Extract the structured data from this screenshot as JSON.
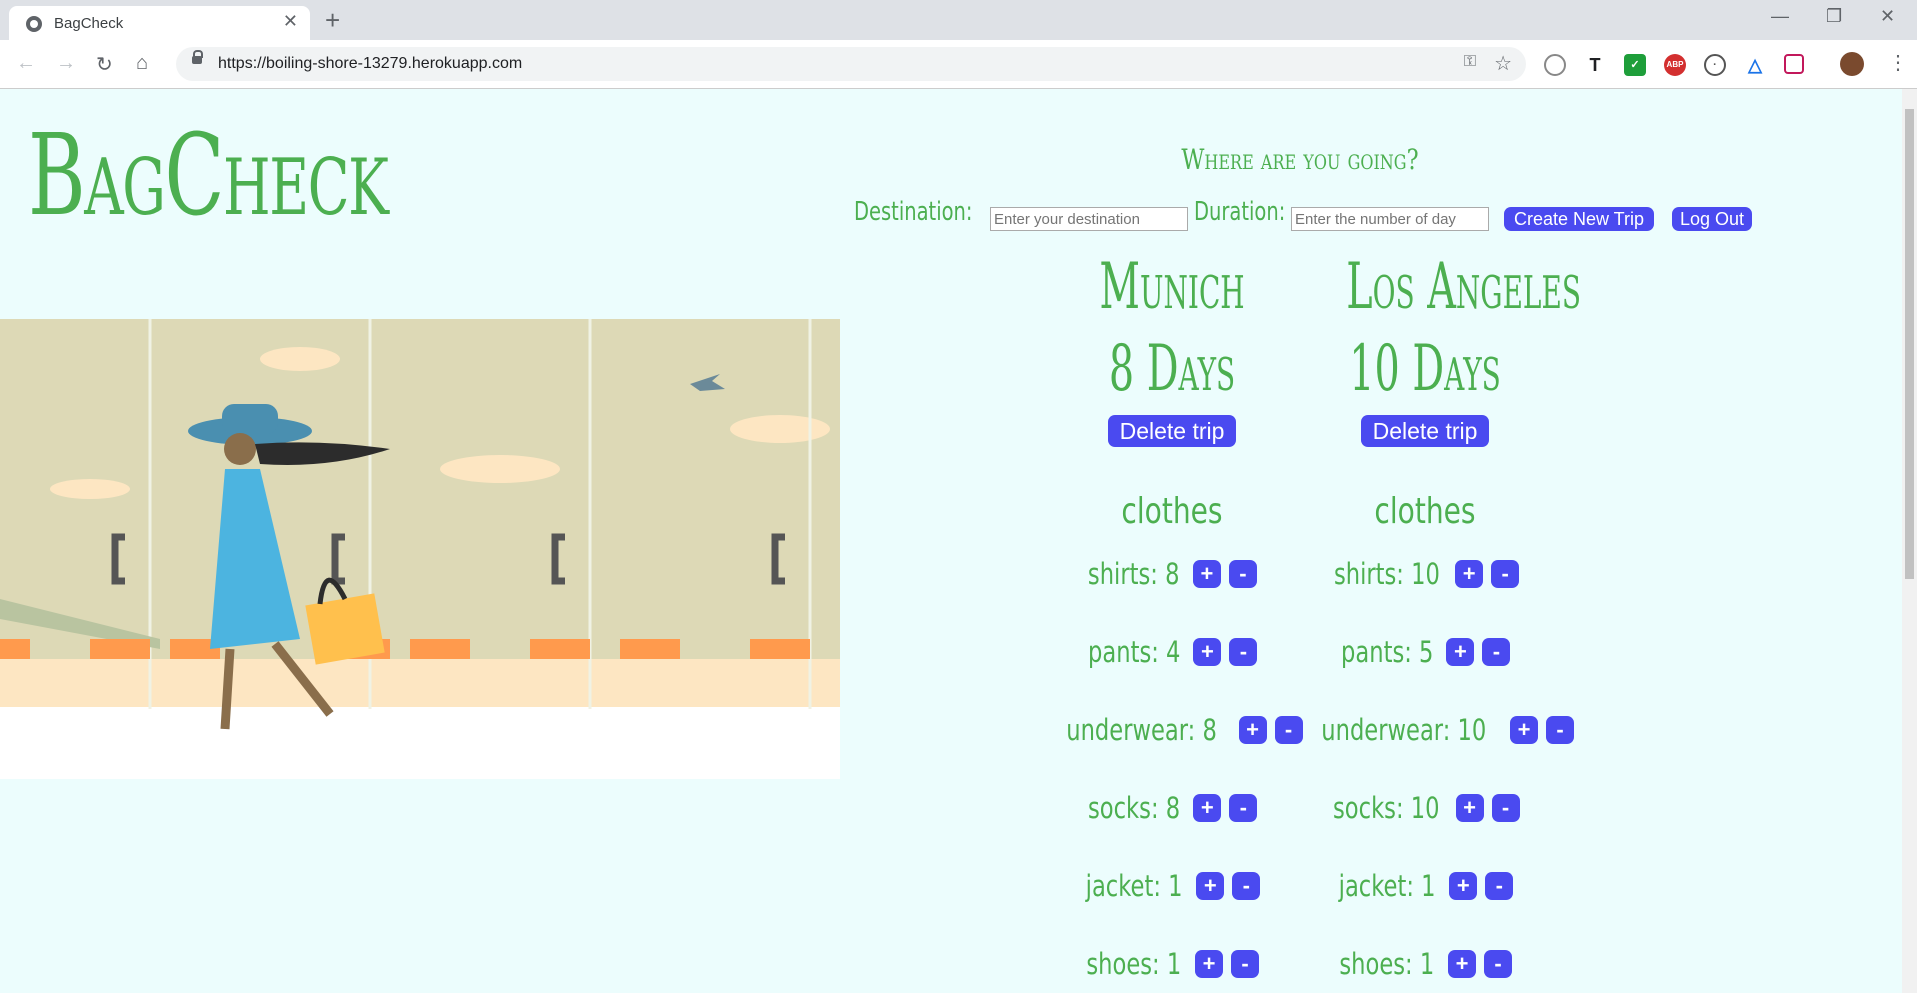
{
  "browser": {
    "tab_title": "BagCheck",
    "url": "https://boiling-shore-13279.herokuapp.com"
  },
  "app": {
    "logo": "BagCheck",
    "heading": "Where are you going?",
    "destination_label": "Destination:",
    "destination_placeholder": "Enter your destination",
    "duration_label": "Duration:",
    "duration_placeholder": "Enter the number of day",
    "create_button": "Create New Trip",
    "logout_button": "Log Out"
  },
  "trips": [
    {
      "destination": "Munich",
      "duration": "8 Days",
      "delete_label": "Delete trip",
      "category": "clothes",
      "items": [
        {
          "text": "shirts: 8"
        },
        {
          "text": "pants: 4"
        },
        {
          "text": "underwear: 8"
        },
        {
          "text": "socks: 8"
        },
        {
          "text": "jacket: 1"
        },
        {
          "text": "shoes: 1"
        }
      ]
    },
    {
      "destination": "Los Angeles",
      "duration": "10 Days",
      "delete_label": "Delete trip",
      "category": "clothes",
      "items": [
        {
          "text": "shirts: 10"
        },
        {
          "text": "pants: 5"
        },
        {
          "text": "underwear: 10"
        },
        {
          "text": "socks: 10"
        },
        {
          "text": "jacket: 1"
        },
        {
          "text": "shoes: 1"
        }
      ]
    }
  ],
  "controls": {
    "plus": "+",
    "minus": "-"
  },
  "colors": {
    "accent_green": "#4caf50",
    "button_blue": "#4a4af0",
    "page_bg": "#ecfdfd"
  }
}
